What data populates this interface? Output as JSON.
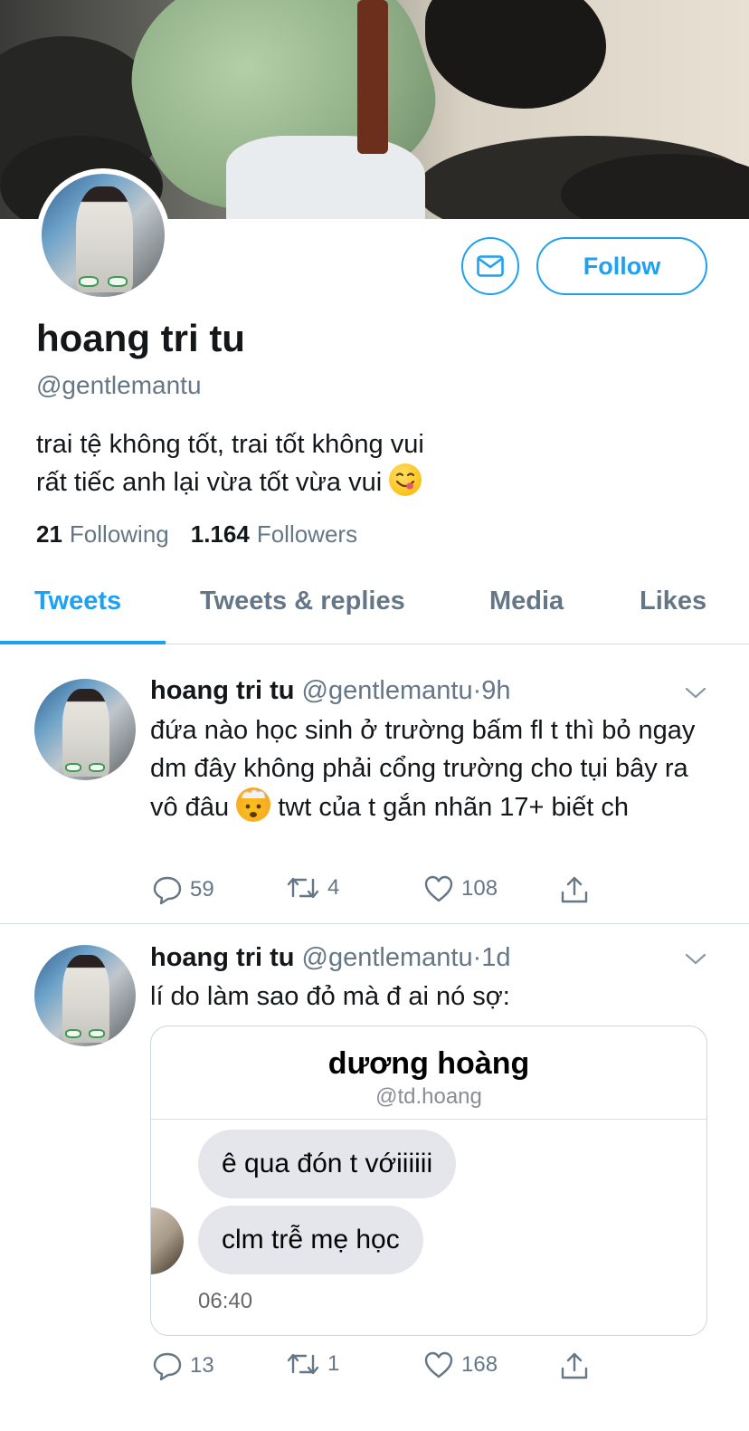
{
  "profile": {
    "name": "hoang tri tu",
    "handle": "@gentlemantu",
    "bio_line1": "trai tệ không tốt, trai tốt không vui",
    "bio_line2": "rất tiếc anh lại vừa tốt vừa vui",
    "following_count": "21",
    "following_label": "Following",
    "followers_count": "1.164",
    "followers_label": "Followers",
    "follow_button": "Follow"
  },
  "tabs": [
    {
      "label": "Tweets",
      "active": true
    },
    {
      "label": "Tweets & replies",
      "active": false
    },
    {
      "label": "Media",
      "active": false
    },
    {
      "label": "Likes",
      "active": false
    }
  ],
  "colors": {
    "accent": "#1da1f2",
    "secondary_text": "#657786",
    "primary_text": "#14171a",
    "divider": "#d6dbdf"
  },
  "tweets": [
    {
      "name": "hoang tri tu",
      "handle": "@gentlemantu",
      "time": "9h",
      "text_part1": "đứa nào học sinh ở trường bấm fl t thì bỏ ngay dm đây không phải cổng trường cho tụi bây ra vô đâu",
      "emoji": "exploding-head-emoji",
      "text_part2": " twt của t gắn nhãn 17+ biết ch",
      "replies": "59",
      "retweets": "4",
      "likes": "108"
    },
    {
      "name": "hoang tri tu",
      "handle": "@gentlemantu",
      "time": "1d",
      "text": "lí do làm sao đỏ mà đ ai nó sợ:",
      "replies": "13",
      "retweets": "1",
      "likes": "168",
      "embed": {
        "title": "dương hoàng",
        "handle": "@td.hoang",
        "messages": [
          "ê qua đón t vớiiiiii",
          "clm trễ mẹ học"
        ],
        "time": "06:40"
      }
    }
  ],
  "icons": {
    "message": "envelope-icon",
    "reply": "reply-icon",
    "retweet": "retweet-icon",
    "like": "heart-icon",
    "share": "share-icon",
    "more": "chevron-down-icon"
  }
}
